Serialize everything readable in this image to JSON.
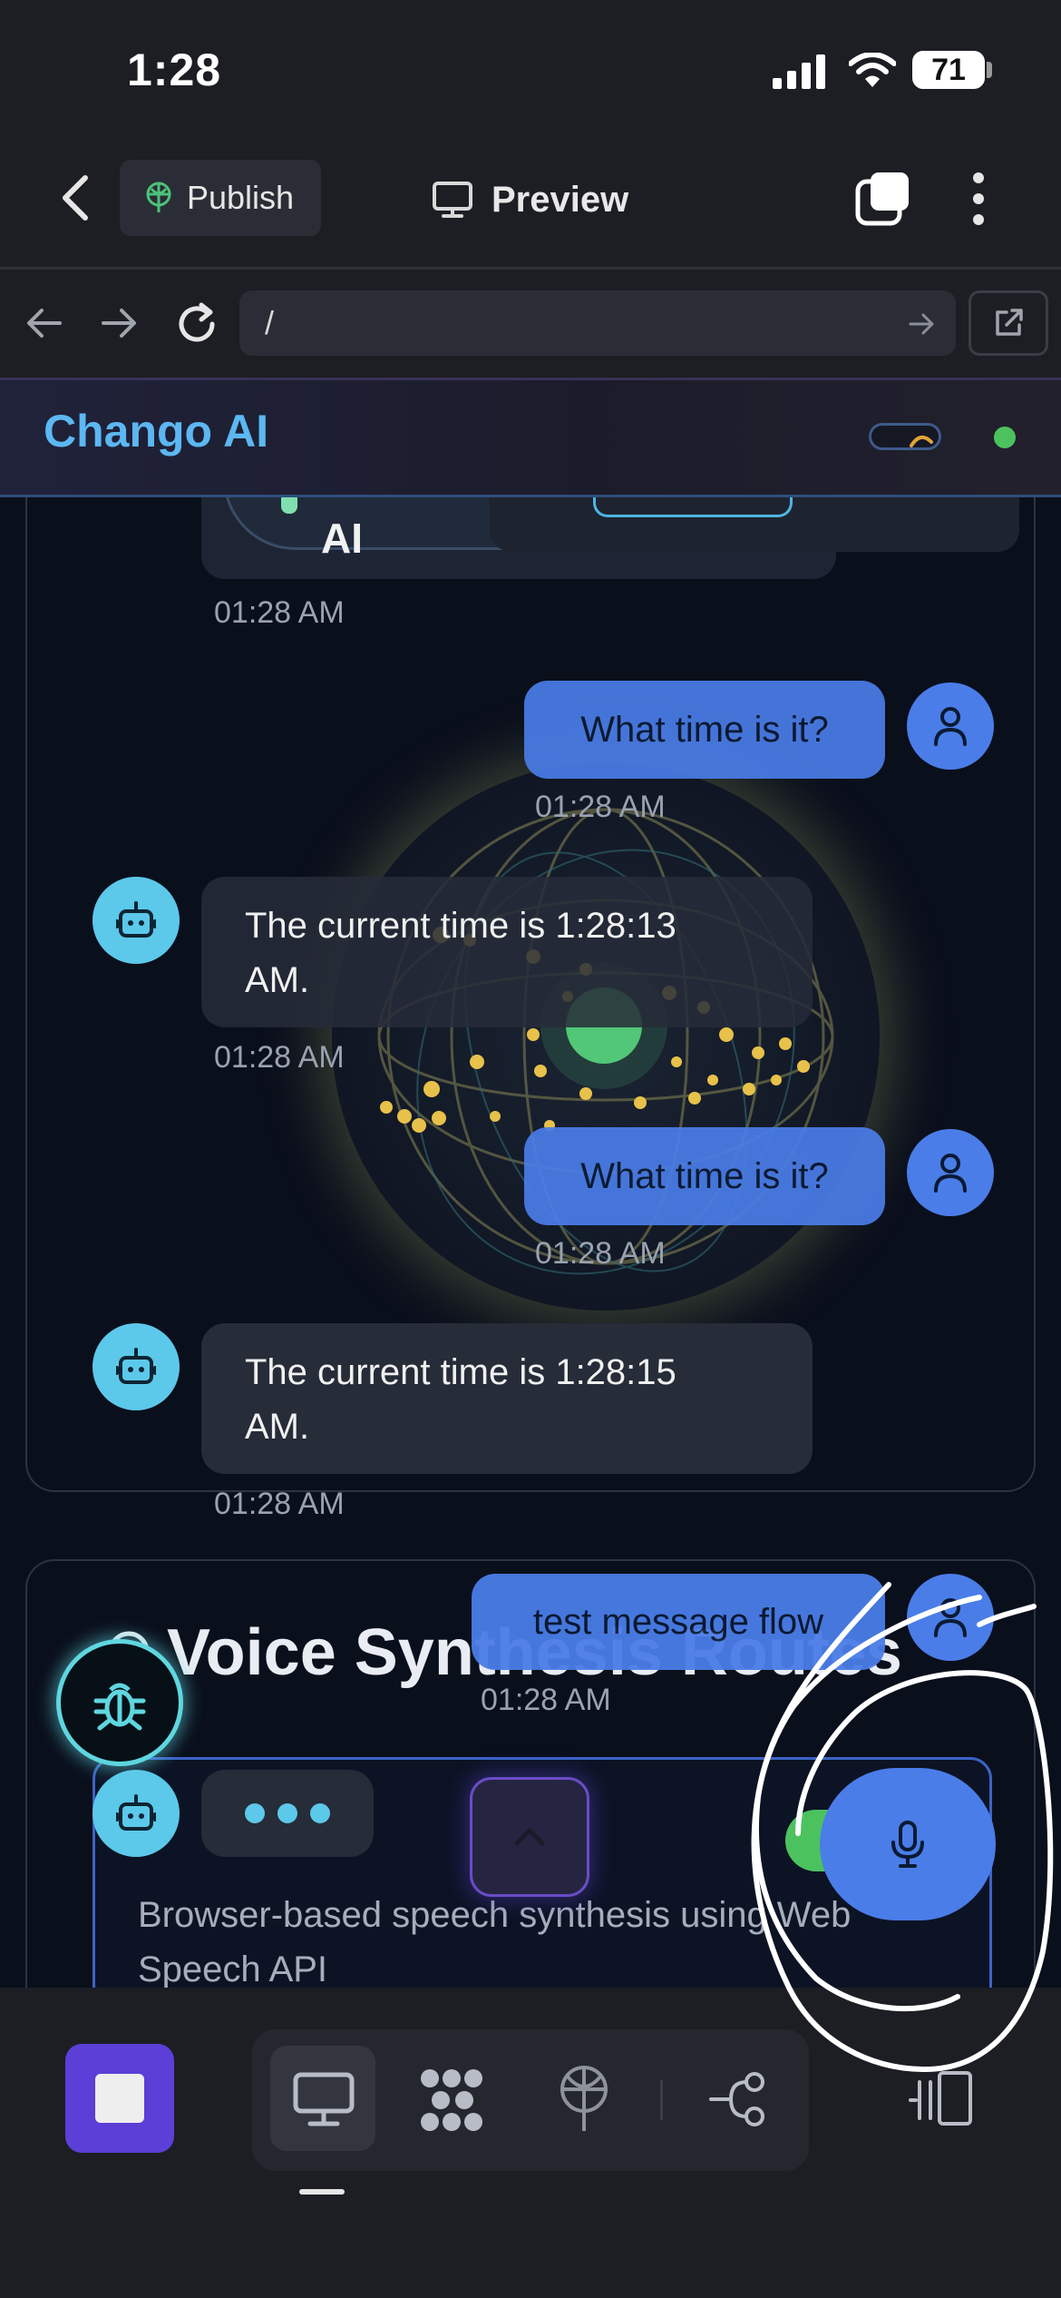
{
  "status_bar": {
    "time": "1:28",
    "battery": "71"
  },
  "top_bar": {
    "publish_label": "Publish",
    "preview_label": "Preview"
  },
  "browser": {
    "url": "/"
  },
  "app": {
    "title": "Chango AI"
  },
  "chat": {
    "partial_bubble_text": "AI",
    "partial_time": "01:28 AM",
    "messages": [
      {
        "role": "user",
        "text": "What time is it?",
        "time": "01:28 AM"
      },
      {
        "role": "assistant",
        "line1": "The current time is 1:28:13",
        "line2": "AM.",
        "time": "01:28 AM"
      },
      {
        "role": "user",
        "text": "What time is it?",
        "time": "01:28 AM"
      },
      {
        "role": "assistant",
        "line1": "The current time is 1:28:15",
        "line2": "AM.",
        "time": "01:28 AM"
      },
      {
        "role": "user",
        "text": "test message flow",
        "time": "01:28 AM"
      }
    ]
  },
  "voice_routes": {
    "title": "Voice Synthesis Routes",
    "desc_line1": "Browser-based speech synthesis using Web",
    "desc_line2": "Speech API"
  },
  "colors": {
    "user_bubble": "#4a7de8",
    "bot_avatar": "#5cc8ea",
    "brand": "#5cb7f2",
    "accent_purple": "#5b3fd6",
    "online": "#4cc25f"
  },
  "icons": [
    "back-chevron-icon",
    "publish-icon",
    "monitor-icon",
    "tabs-icon",
    "more-vertical-icon",
    "arrow-left-icon",
    "arrow-right-icon",
    "reload-icon",
    "external-link-icon",
    "user-icon",
    "bot-icon",
    "bug-icon",
    "chevron-up-icon",
    "mic-icon",
    "stop-icon",
    "workspace-icon",
    "publish-icon",
    "integrations-icon",
    "split-view-icon"
  ]
}
